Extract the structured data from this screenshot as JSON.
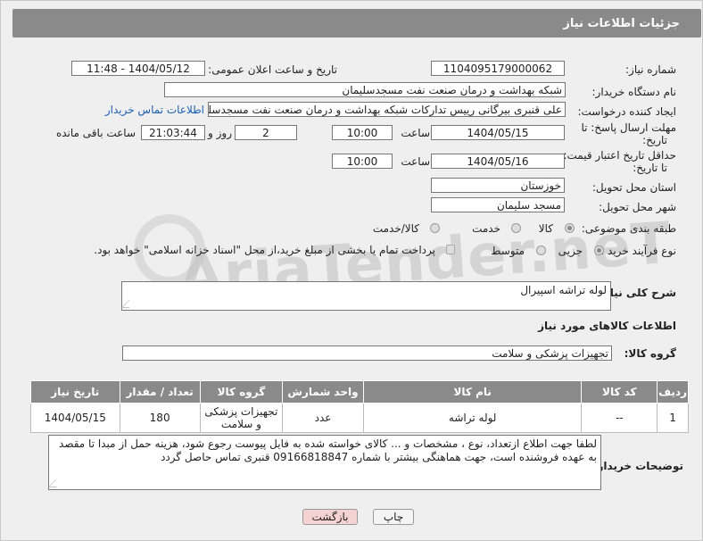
{
  "header": {
    "title": "جزئیات اطلاعات نیاز"
  },
  "fields": {
    "need_number_label": "شماره نیاز:",
    "need_number": "1104095179000062",
    "announce_label": "تاریخ و ساعت اعلان عمومی:",
    "announce_value": "1404/05/12 - 11:48",
    "buyer_org_label": "نام دستگاه خریدار:",
    "buyer_org": "شبکه بهداشت و درمان صنعت نفت مسجدسلیمان",
    "creator_label": "ایجاد کننده درخواست:",
    "creator": "علی قنبری بیرگانی رییس تدارکات شبکه بهداشت و درمان صنعت نفت مسجدسلیمان",
    "contact_link": "اطلاعات تماس خریدار",
    "deadline_label_1": "مهلت ارسال پاسخ: تا",
    "deadline_label_2": "تاریخ:",
    "deadline_date": "1404/05/15",
    "time_label": "ساعت",
    "deadline_time": "10:00",
    "days_count": "2",
    "days_label": "روز و",
    "remaining_time": "21:03:44",
    "remaining_label": "ساعت باقی مانده",
    "validity_label_1": "حداقل تاریخ اعتبار قیمت:",
    "validity_label_2": "تا تاریخ:",
    "validity_date": "1404/05/16",
    "validity_time": "10:00",
    "province_label": "استان محل تحویل:",
    "province": "خوزستان",
    "city_label": "شهر محل تحویل:",
    "city": "مسجد سلیمان",
    "category_label": "طبقه بندی موضوعی:",
    "category_options": [
      "کالا",
      "خدمت",
      "کالا/خدمت"
    ],
    "process_label": "نوع فرآیند خرید :",
    "process_options": [
      "جزیی",
      "متوسط"
    ],
    "payment_note": "پرداخت تمام یا بخشی از مبلغ خرید،از محل \"اسناد خزانه اسلامی\" خواهد بود.",
    "description_label": "شرح کلی نیاز:",
    "description": "لوله تراشه اسپیرال",
    "goods_info_title": "اطلاعات کالاهای مورد نیاز",
    "goods_group_label": "گروه کالا:",
    "goods_group": "تجهیزات پزشکی و سلامت"
  },
  "table": {
    "headers": [
      "ردیف",
      "کد کالا",
      "نام کالا",
      "واحد شمارش",
      "گروه کالا",
      "تعداد / مقدار",
      "تاریخ نیاز"
    ],
    "rows": [
      [
        "1",
        "--",
        "لوله تراشه",
        "عدد",
        "تجهیزات پزشکی و سلامت",
        "180",
        "1404/05/15"
      ]
    ]
  },
  "buyer_notes": {
    "label": "توضیحات خریدار:",
    "text": "لطفا جهت اطلاع ازتعداد،  نوع ، مشخصات و ... کالای خواسته شده به فایل پیوست رجوع شود، هزینه حمل از مبدا تا مقصد به عهده فروشنده است، جهت هماهنگی بیشتر با شماره 09166818847 قنبری تماس حاصل گردد"
  },
  "buttons": {
    "print": "چاپ",
    "back": "بازگشت"
  },
  "watermark": "AriaTender.neT",
  "colors": {
    "header": "#8a8a8a",
    "link": "#1a5fb4",
    "back_button": "#f6d3d3"
  }
}
